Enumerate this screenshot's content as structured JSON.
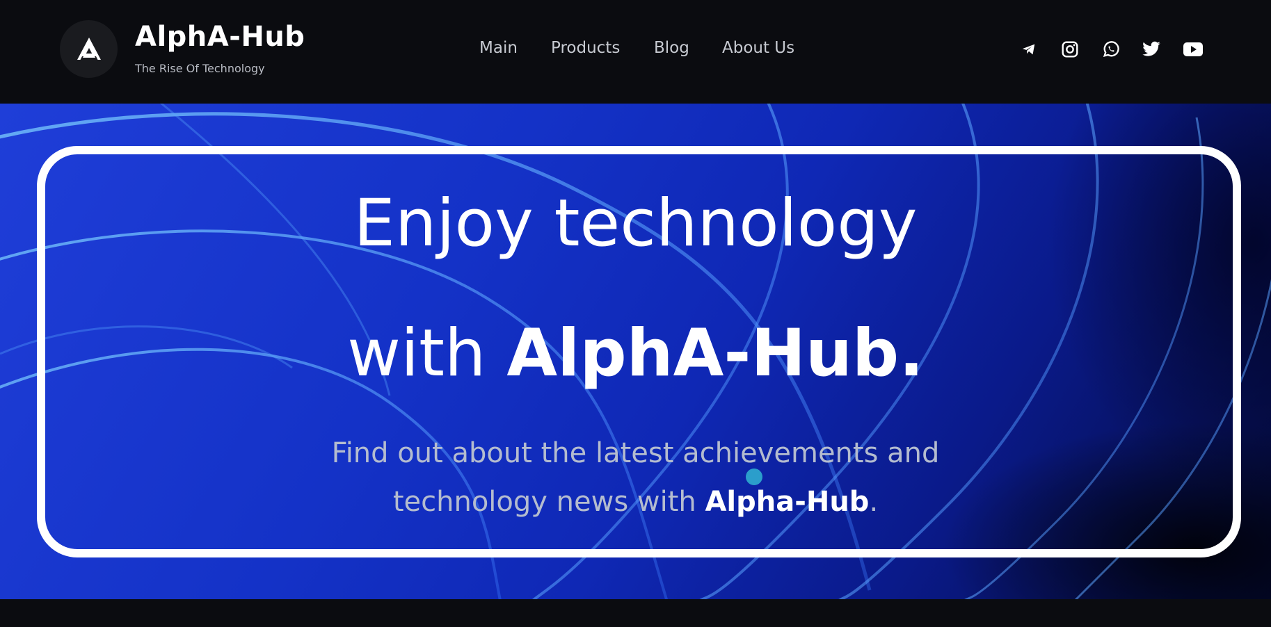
{
  "header": {
    "brand_title": "AlphA-Hub",
    "brand_subtitle": "The Rise Of Technology",
    "nav": [
      "Main",
      "Products",
      "Blog",
      "About Us"
    ],
    "social_icons": [
      "telegram-icon",
      "instagram-icon",
      "whatsapp-icon",
      "twitter-icon",
      "youtube-icon"
    ]
  },
  "hero": {
    "line1": "Enjoy technology",
    "line2_prefix": "with ",
    "line2_brand": "AlphA-Hub.",
    "lead_line1": "Find out about the latest achievements and",
    "lead_line2_prefix": "technology news with ",
    "lead_line2_brand": "Alpha-Hub",
    "lead_line2_suffix": "."
  },
  "colors": {
    "background": "#0b0c10",
    "hero_blue": "#1432c7",
    "frame": "#ffffff",
    "cursor_dot": "#2b9ecb"
  }
}
